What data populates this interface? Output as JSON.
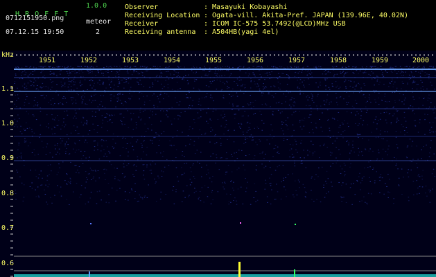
{
  "app": {
    "name": "H R O F F T",
    "version": "1.0.0"
  },
  "file": {
    "name": "0712151950.png",
    "datetime": "07.12.15 19:50"
  },
  "meteor": {
    "label": "meteor",
    "count": "2"
  },
  "info": [
    {
      "key": "Observer",
      "value": ": Masayuki Kobayashi"
    },
    {
      "key": "Receiving Location",
      "value": ": Ogata-vill. Akita-Pref. JAPAN (139.96E, 40.02N)"
    },
    {
      "key": "Receiver",
      "value": ": ICOM IC-575 53.7492(@LCD)MHz USB"
    },
    {
      "key": "Receiving antenna",
      "value": ": A504HB(yagi 4el)"
    }
  ],
  "spectrogram": {
    "y_unit": "kHz",
    "y_ticks": [
      "1.1",
      "1.0",
      "0.9",
      "0.8",
      "0.7",
      "0.6"
    ],
    "time_ticks": [
      "1951",
      "1952",
      "1953",
      "1954",
      "1955",
      "1956",
      "1957",
      "1958",
      "1959",
      "2000"
    ],
    "colors": {
      "background": "#000022",
      "noise": "#2a3aa8",
      "carrier": "#6fa8ff",
      "tick": "#ffffff",
      "label": "#ffff66"
    }
  }
}
